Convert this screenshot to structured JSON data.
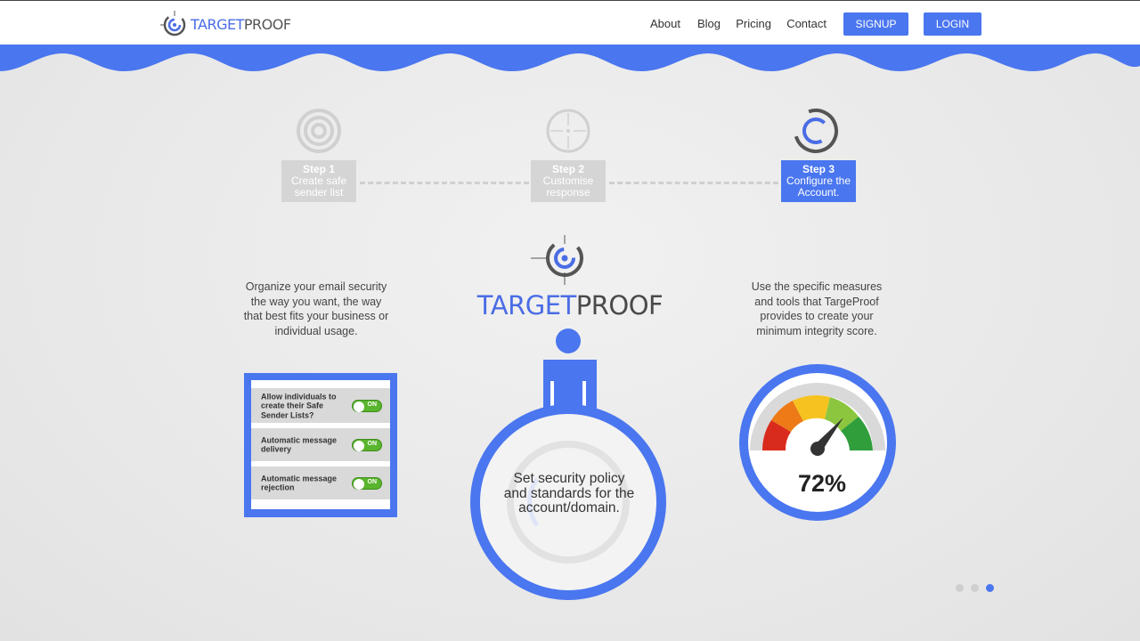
{
  "brand": {
    "logo_text_a": "TARGET",
    "logo_text_b": "PROOF"
  },
  "nav": {
    "links": [
      "About",
      "Blog",
      "Pricing",
      "Contact"
    ],
    "signup": "SIGNUP",
    "login": "LOGIN"
  },
  "steps": [
    {
      "title": "Step 1",
      "desc_line1": "Create safe",
      "desc_line2": "sender list",
      "active": false
    },
    {
      "title": "Step 2",
      "desc_line1": "Customise",
      "desc_line2": "response",
      "active": false
    },
    {
      "title": "Step 3",
      "desc_line1": "Configure the",
      "desc_line2": "Account.",
      "active": true
    }
  ],
  "left_text": {
    "line1": "Organize your email security",
    "line2": "the way you want, the way",
    "line3": "that best fits your business or",
    "line4": "individual usage."
  },
  "right_text": {
    "line1": "Use the specific measures",
    "line2": "and tools that TargeProof",
    "line3": "provides to create your",
    "line4": "minimum integrity score."
  },
  "toggles": [
    {
      "line1": "Allow individuals to",
      "line2": "create their Safe",
      "line3": "Sender Lists?",
      "state": "ON"
    },
    {
      "line1": "Automatic message",
      "line2": "delivery",
      "line3": "",
      "state": "ON"
    },
    {
      "line1": "Automatic message",
      "line2": "rejection",
      "line3": "",
      "state": "ON"
    }
  ],
  "policy": {
    "line1": "Set security policy",
    "line2": "and standards for the",
    "line3": "account/domain."
  },
  "gauge": {
    "value": "72%",
    "level": 0.72
  },
  "carousel": {
    "count": 3,
    "active_index": 2
  },
  "colors": {
    "accent": "#4a76ef",
    "toggle_on": "#5ab52e",
    "step_inactive": "#d5d5d5",
    "background": "#ebebeb"
  }
}
